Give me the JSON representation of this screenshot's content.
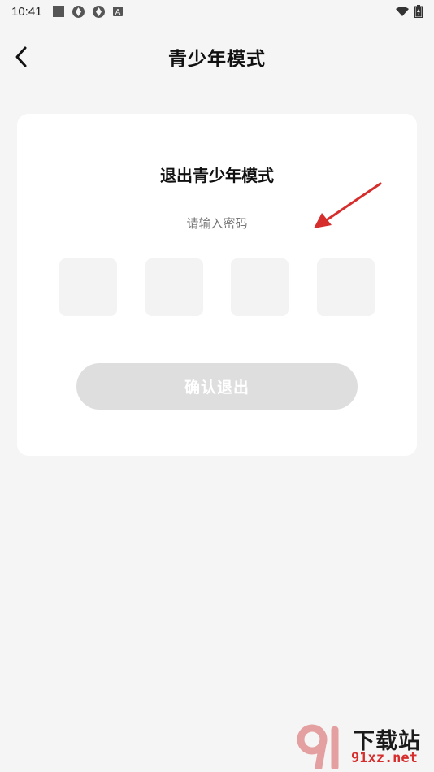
{
  "status_bar": {
    "time": "10:41",
    "icons": [
      "square-icon",
      "hex-icon-1",
      "hex-icon-2",
      "a-badge-icon"
    ],
    "right_icons": [
      "wifi-icon",
      "battery-icon"
    ]
  },
  "header": {
    "title": "青少年模式",
    "back_icon": "chevron-left-icon"
  },
  "card": {
    "title": "退出青少年模式",
    "subtitle": "请输入密码",
    "pin": [
      "",
      "",
      "",
      ""
    ],
    "confirm_label": "确认退出"
  },
  "watermark": {
    "brand": "下载站",
    "url": "91xz.net"
  },
  "colors": {
    "background": "#f5f5f5",
    "card": "#ffffff",
    "pin_box": "#f3f3f3",
    "button_disabled": "#dedede",
    "arrow": "#d62d2d"
  }
}
